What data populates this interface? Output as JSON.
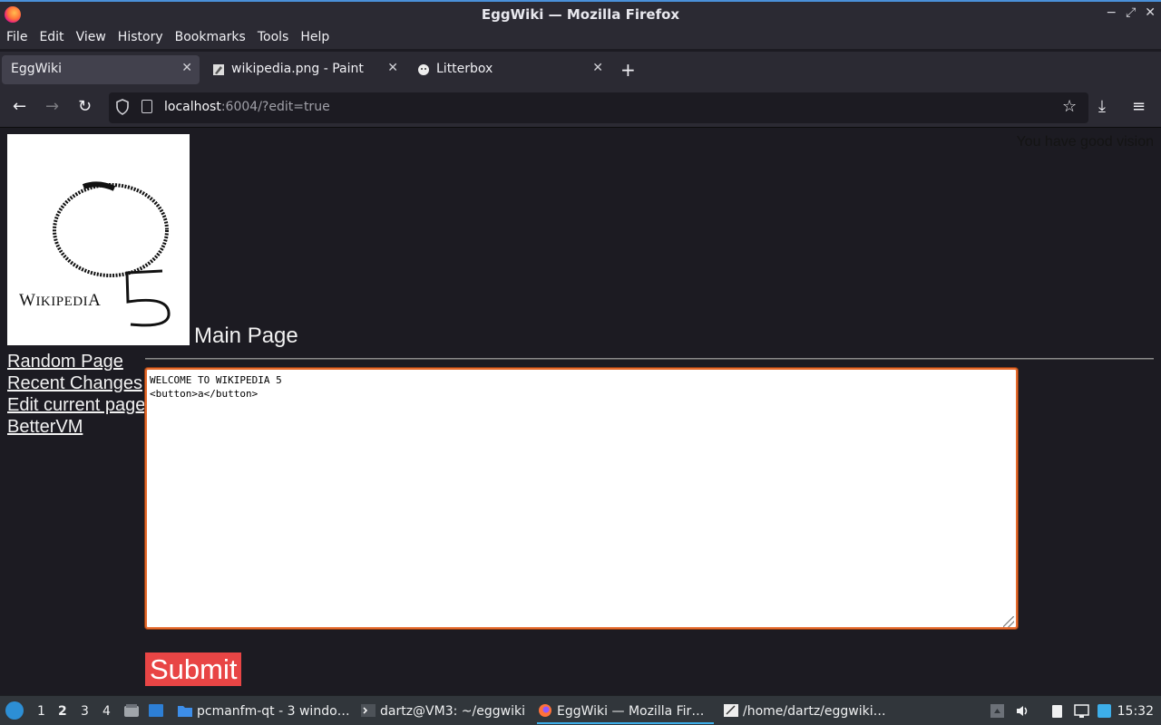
{
  "window": {
    "title": "EggWiki — Mozilla Firefox",
    "controls": [
      "−",
      "⤢",
      "✕"
    ]
  },
  "menu": [
    "File",
    "Edit",
    "View",
    "History",
    "Bookmarks",
    "Tools",
    "Help"
  ],
  "tabs": [
    {
      "label": "EggWiki",
      "active": true
    },
    {
      "label": "wikipedia.png - Paint",
      "active": false
    },
    {
      "label": "Litterbox",
      "active": false
    }
  ],
  "tab_close": "✕",
  "new_tab": "+",
  "nav": {
    "back": "←",
    "forward": "→",
    "reload": "↻",
    "url_host": "localhost",
    "url_rest": ":6004/?edit=true",
    "bookmark": "☆",
    "download": "⤓",
    "menu": "≡"
  },
  "page": {
    "logo_text_big_w": "W",
    "logo_text_small_1": "IKIPEDI",
    "logo_text_big_a": "A",
    "heading": "Main Page",
    "vision_text": "You have good vision",
    "sidebar": [
      "Random Page",
      "Recent Changes",
      "Edit current page",
      "BetterVM"
    ],
    "editor_value": "WELCOME TO WIKIPEDIA 5\n<button>a</button>",
    "submit_label": "Submit"
  },
  "taskbar": {
    "desktops": [
      "1",
      "2",
      "3",
      "4"
    ],
    "active_desktop": "2",
    "tasks": [
      {
        "label": "pcmanfm-qt - 3 windo…",
        "icon": "folder-icon"
      },
      {
        "label": "dartz@VM3: ~/eggwiki",
        "icon": "terminal-icon"
      },
      {
        "label": "EggWiki — Mozilla Fir…",
        "icon": "firefox-icon"
      },
      {
        "label": "/home/dartz/eggwiki…",
        "icon": "text-editor-icon"
      }
    ],
    "clock": "15:32"
  },
  "colors": {
    "accent": "#3daee9",
    "editor_focus": "#e66a2c",
    "submit_bg": "#e84545",
    "page_bg": "#1c1b22"
  }
}
